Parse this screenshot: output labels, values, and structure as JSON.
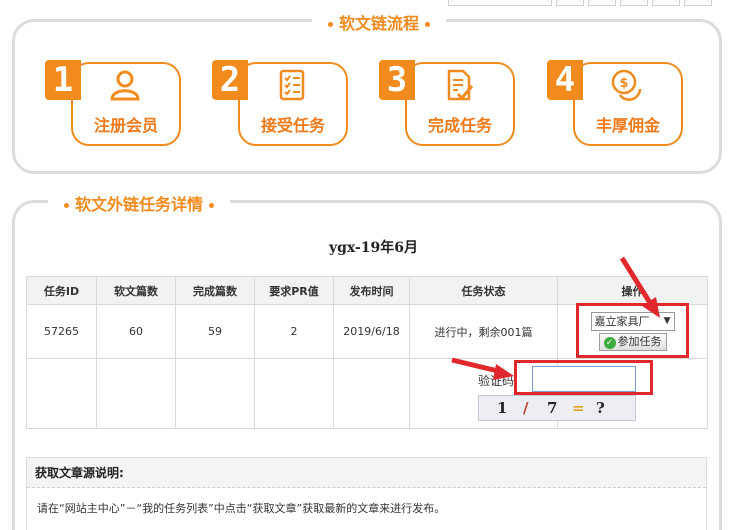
{
  "process": {
    "title": "软文链流程",
    "steps": [
      {
        "num": "1",
        "label": "注册会员",
        "icon": "user-icon"
      },
      {
        "num": "2",
        "label": "接受任务",
        "icon": "checklist-icon"
      },
      {
        "num": "3",
        "label": "完成任务",
        "icon": "document-check-icon"
      },
      {
        "num": "4",
        "label": "丰厚佣金",
        "icon": "coin-icon"
      }
    ]
  },
  "details": {
    "title": "软文外链任务详情",
    "task_name": "ygx-19年6月",
    "headers": [
      "任务ID",
      "软文篇数",
      "完成篇数",
      "要求PR值",
      "发布时间",
      "任务状态",
      "操作"
    ],
    "row": {
      "id": "57265",
      "articles": "60",
      "completed": "59",
      "pr": "2",
      "publish_date": "2019/6/18",
      "status": "进行中，剩余001篇"
    },
    "select_value": "嘉立家具厂",
    "join_label": "参加任务",
    "verify_label": "验证码:",
    "verify_value": "",
    "captcha": [
      "1",
      "/",
      "7",
      "=",
      "?"
    ]
  },
  "note": {
    "title": "获取文章源说明:",
    "text": "请在“网站主中心”－“我的任务列表”中点击“获取文章”获取最新的文章来进行发布。"
  },
  "colors": {
    "accent": "#f28b1e",
    "highlight": "#e0282d",
    "border": "#dcdcdc"
  }
}
